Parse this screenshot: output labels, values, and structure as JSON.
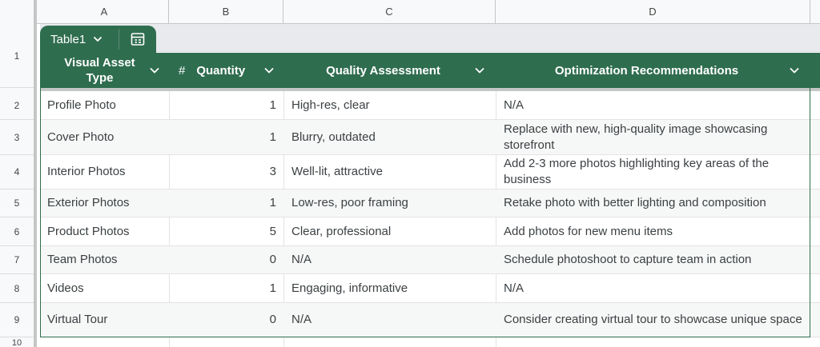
{
  "columns": [
    "A",
    "B",
    "C",
    "D"
  ],
  "row_numbers": [
    "1",
    "2",
    "3",
    "4",
    "5",
    "6",
    "7",
    "8",
    "9",
    "10"
  ],
  "table": {
    "name": "Table1",
    "dropdown_icon": "chevron-down-icon",
    "view_icon": "table-grid-icon",
    "header_color": "#2f6d4f",
    "headers": [
      {
        "label": "Visual Asset Type",
        "type_icon": ""
      },
      {
        "label": "Quantity",
        "type_icon": "#"
      },
      {
        "label": "Quality Assessment",
        "type_icon": ""
      },
      {
        "label": "Optimization Recommendations",
        "type_icon": ""
      }
    ],
    "rows": [
      {
        "type": "Profile Photo",
        "quantity": "1",
        "quality": "High-res, clear",
        "recommendation": "N/A"
      },
      {
        "type": "Cover Photo",
        "quantity": "1",
        "quality": "Blurry, outdated",
        "recommendation": "Replace with new, high-quality image showcasing storefront"
      },
      {
        "type": "Interior Photos",
        "quantity": "3",
        "quality": "Well-lit, attractive",
        "recommendation": "Add 2-3 more photos highlighting key areas of the business"
      },
      {
        "type": "Exterior Photos",
        "quantity": "1",
        "quality": "Low-res, poor framing",
        "recommendation": "Retake photo with better lighting and composition"
      },
      {
        "type": "Product Photos",
        "quantity": "5",
        "quality": "Clear, professional",
        "recommendation": "Add photos for new menu items"
      },
      {
        "type": "Team Photos",
        "quantity": "0",
        "quality": "N/A",
        "recommendation": "Schedule photoshoot to capture team in action"
      },
      {
        "type": "Videos",
        "quantity": "1",
        "quality": "Engaging, informative",
        "recommendation": "N/A"
      },
      {
        "type": "Virtual Tour",
        "quantity": "0",
        "quality": "N/A",
        "recommendation": "Consider creating virtual tour to showcase unique space"
      }
    ]
  }
}
